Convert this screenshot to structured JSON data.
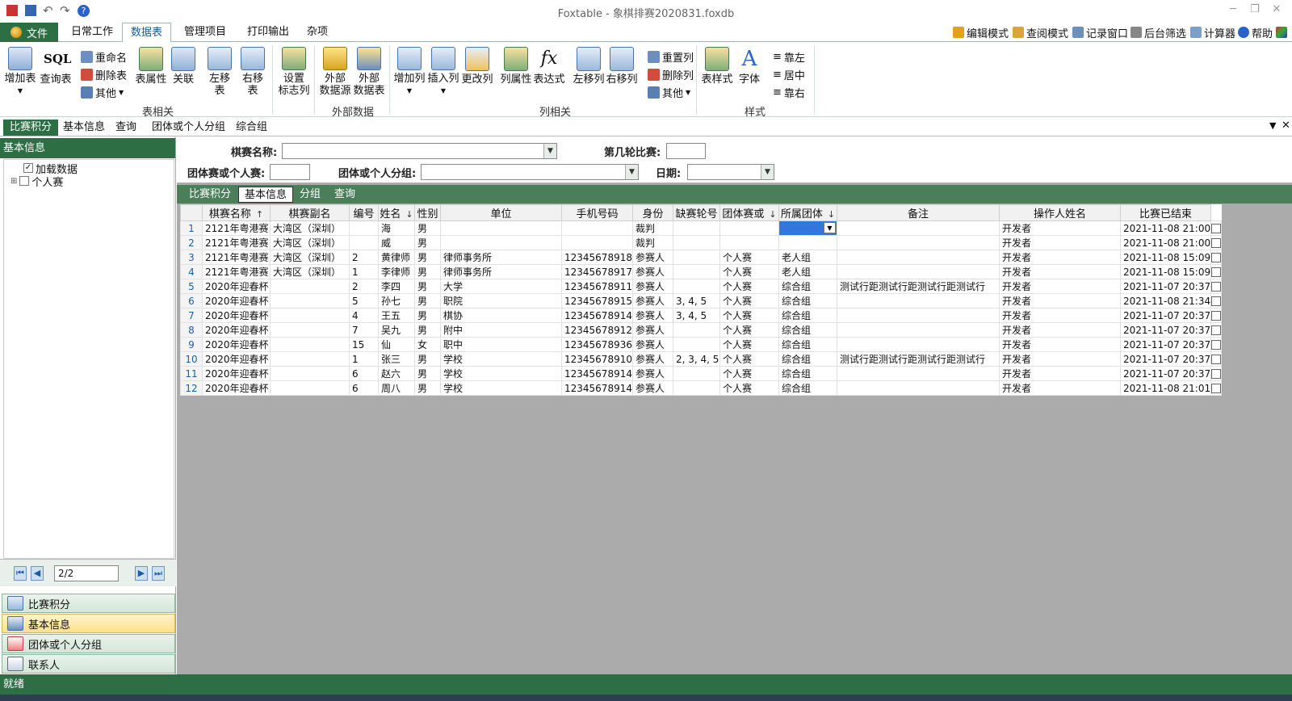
{
  "window": {
    "title": "Foxtable - 象棋排赛2020831.foxdb"
  },
  "menu": {
    "file": "文件",
    "tabs": [
      "日常工作",
      "数据表",
      "管理项目",
      "打印输出",
      "杂项"
    ],
    "right": [
      "编辑模式",
      "查阅模式",
      "记录窗口",
      "后台筛选",
      "计算器",
      "帮助"
    ]
  },
  "ribbon": {
    "buttons": {
      "add_table": "增加表",
      "sql_table": "查询表",
      "rename": "重命名",
      "delete_table": "删除表",
      "other1": "其他",
      "table_props": "表属性",
      "relation": "关联",
      "move_left": "左移表",
      "move_right": "右移表",
      "set_flag_1": "设置",
      "set_flag_2": "标志列",
      "ext_src_1": "外部",
      "ext_src_2": "数据源",
      "ext_tbl_1": "外部",
      "ext_tbl_2": "数据表",
      "add_col": "增加列",
      "insert_col": "插入列",
      "change_col": "更改列",
      "col_props": "列属性",
      "expression": "表达式",
      "col_left": "左移列",
      "col_right": "右移列",
      "reset_col": "重置列",
      "delete_col": "删除列",
      "other2": "其他",
      "table_style": "表样式",
      "font": "字体",
      "align_left": "靠左",
      "align_center": "居中",
      "align_right": "靠右"
    },
    "groups": {
      "table": "表相关",
      "external": "外部数据",
      "column": "列相关",
      "style": "样式"
    }
  },
  "doc_tabs": [
    "比赛积分",
    "基本信息",
    "查询",
    "团体或个人分组",
    "综合组"
  ],
  "left_panel": {
    "header": "基本信息",
    "tree": [
      {
        "label": "加载数据",
        "checked": true
      },
      {
        "label": "个人赛",
        "checked": false
      }
    ],
    "page": "2/2",
    "outlook": [
      "比赛积分",
      "基本信息",
      "团体或个人分组",
      "联系人"
    ]
  },
  "filter": {
    "match_name": "棋赛名称:",
    "round": "第几轮比赛:",
    "team_or_single": "团体赛或个人赛:",
    "group": "团体或个人分组:",
    "date": "日期:"
  },
  "sub_tabs": [
    "比赛积分",
    "基本信息",
    "分组",
    "查询"
  ],
  "grid": {
    "columns": [
      "棋赛名称",
      "棋赛副名",
      "编号",
      "姓名",
      "性别",
      "单位",
      "手机号码",
      "身份",
      "缺赛轮号",
      "团体赛或",
      "所属团体",
      "备注",
      "操作人姓名",
      "比赛已结束"
    ],
    "rows": [
      [
        "1",
        "2121年粤港赛",
        "大湾区（深圳）",
        "",
        "海",
        "男",
        "",
        "",
        "裁判",
        "",
        "",
        "",
        "",
        "开发者",
        "2021-11-08 21:00"
      ],
      [
        "2",
        "2121年粤港赛",
        "大湾区（深圳）",
        "",
        "威",
        "男",
        "",
        "",
        "裁判",
        "",
        "",
        "",
        "",
        "开发者",
        "2021-11-08 21:00"
      ],
      [
        "3",
        "2121年粤港赛",
        "大湾区（深圳）",
        "2",
        "黄律师",
        "男",
        "律师事务所",
        "12345678918",
        "参赛人",
        "",
        "个人赛",
        "老人组",
        "",
        "开发者",
        "2021-11-08 15:09"
      ],
      [
        "4",
        "2121年粤港赛",
        "大湾区（深圳）",
        "1",
        "李律师",
        "男",
        "律师事务所",
        "12345678917",
        "参赛人",
        "",
        "个人赛",
        "老人组",
        "",
        "开发者",
        "2021-11-08 15:09"
      ],
      [
        "5",
        "2020年迎春杯",
        "",
        "2",
        "李四",
        "男",
        "大学",
        "12345678911",
        "参赛人",
        "",
        "个人赛",
        "综合组",
        "测试行距测试行距测试行距测试行",
        "开发者",
        "2021-11-07 20:37"
      ],
      [
        "6",
        "2020年迎春杯",
        "",
        "5",
        "孙七",
        "男",
        "职院",
        "12345678915",
        "参赛人",
        "3, 4, 5",
        "个人赛",
        "综合组",
        "",
        "开发者",
        "2021-11-08 21:34"
      ],
      [
        "7",
        "2020年迎春杯",
        "",
        "4",
        "王五",
        "男",
        "棋协",
        "12345678914",
        "参赛人",
        "3, 4, 5",
        "个人赛",
        "综合组",
        "",
        "开发者",
        "2021-11-07 20:37"
      ],
      [
        "8",
        "2020年迎春杯",
        "",
        "7",
        "吴九",
        "男",
        "附中",
        "12345678912",
        "参赛人",
        "",
        "个人赛",
        "综合组",
        "",
        "开发者",
        "2021-11-07 20:37"
      ],
      [
        "9",
        "2020年迎春杯",
        "",
        "15",
        "仙",
        "女",
        "职中",
        "12345678936",
        "参赛人",
        "",
        "个人赛",
        "综合组",
        "",
        "开发者",
        "2021-11-07 20:37"
      ],
      [
        "10",
        "2020年迎春杯",
        "",
        "1",
        "张三",
        "男",
        "学校",
        "12345678910",
        "参赛人",
        "2, 3, 4, 5",
        "个人赛",
        "综合组",
        "测试行距测试行距测试行距测试行",
        "开发者",
        "2021-11-07 20:37"
      ],
      [
        "11",
        "2020年迎春杯",
        "",
        "6",
        "赵六",
        "男",
        "学校",
        "12345678914",
        "参赛人",
        "",
        "个人赛",
        "综合组",
        "",
        "开发者",
        "2021-11-07 20:37"
      ],
      [
        "12",
        "2020年迎春杯",
        "",
        "6",
        "周八",
        "男",
        "学校",
        "12345678914",
        "参赛人",
        "",
        "个人赛",
        "综合组",
        "",
        "开发者",
        "2021-11-08 21:01"
      ]
    ]
  },
  "status": "就绪",
  "colors": {
    "accent": "#2d6e44",
    "grid_bg": "#ababab",
    "selection": "#3377dd"
  }
}
